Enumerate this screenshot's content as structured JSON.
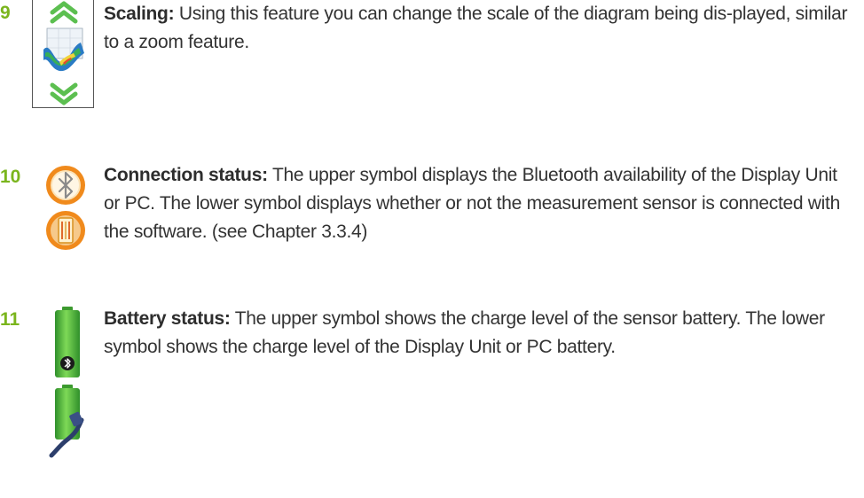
{
  "items": [
    {
      "number": "9",
      "term": "Scaling:",
      "description": "Using this feature you can change the scale of the diagram being dis-played, similar to a zoom feature.",
      "icons": [
        "chevron-up-double-icon",
        "surface-plot-icon",
        "chevron-down-double-icon"
      ]
    },
    {
      "number": "10",
      "term": "Connection status:",
      "description": "The upper symbol displays the Bluetooth availability of the Display Unit or PC. The lower symbol displays whether or not the measurement sensor is connected with the software. (see Chapter 3.3.4)",
      "icons": [
        "bluetooth-icon",
        "sensor-connection-icon"
      ]
    },
    {
      "number": "11",
      "term": "Battery status:",
      "description": "The upper symbol shows the charge level of the sensor battery. The lower symbol shows the charge level of the Display Unit or PC battery.",
      "icons": [
        "battery-bluetooth-icon",
        "battery-plug-icon"
      ]
    }
  ],
  "colors": {
    "accent": "#7ab51d",
    "text": "#333333",
    "icon_orange": "#f08a1c",
    "icon_green": "#4caf3a"
  }
}
